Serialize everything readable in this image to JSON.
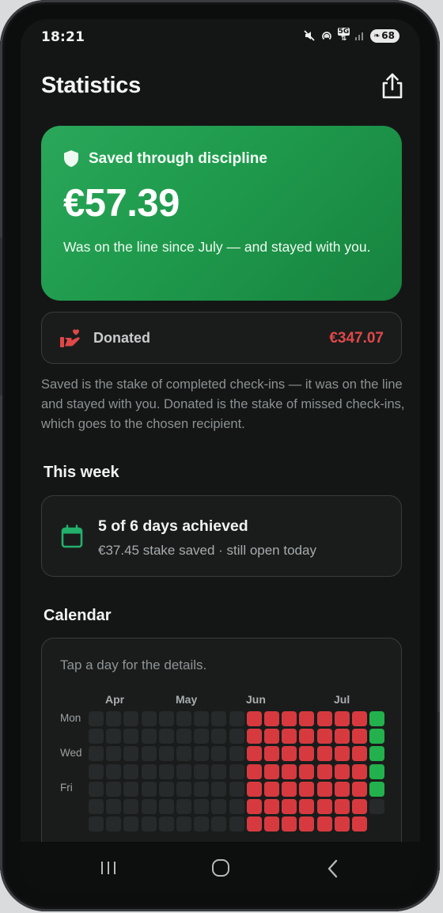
{
  "status_bar": {
    "time": "18:21",
    "network": "5G",
    "battery": "68",
    "icons": [
      "mute-icon",
      "hotspot-icon",
      "5g-icon",
      "signal-icon",
      "battery-icon"
    ]
  },
  "header": {
    "title": "Statistics",
    "share_icon": "share-icon"
  },
  "saved": {
    "label": "Saved through discipline",
    "icon": "shield-icon",
    "amount": "€57.39",
    "note": "Was on the line since July — and stayed with you.",
    "color": "#22a352"
  },
  "donated": {
    "label": "Donated",
    "icon": "heart-hand-icon",
    "amount": "€347.07",
    "color": "#e04848"
  },
  "explanation": "Saved is the stake of completed check-ins — it was on the line and stayed with you. Donated is the stake of missed check-ins, which goes to the chosen recipient.",
  "this_week": {
    "title": "This week",
    "icon": "calendar-icon",
    "summary": "5 of 6 days achieved",
    "detail": "€37.45 stake saved · still open today"
  },
  "calendar": {
    "title": "Calendar",
    "hint": "Tap a day for the details.",
    "months": [
      "Apr",
      "May",
      "Jun",
      "Jul"
    ],
    "day_labels": [
      "Mon",
      "Wed",
      "Fri"
    ],
    "legend_colors": {
      "empty": "#262a2a",
      "missed": "#d63a3f",
      "achieved": "#22b14c"
    },
    "weeks": [
      [
        0,
        0,
        0,
        0,
        0,
        0,
        0
      ],
      [
        0,
        0,
        0,
        0,
        0,
        0,
        0
      ],
      [
        0,
        0,
        0,
        0,
        0,
        0,
        0
      ],
      [
        0,
        0,
        0,
        0,
        0,
        0,
        0
      ],
      [
        0,
        0,
        0,
        0,
        0,
        0,
        0
      ],
      [
        0,
        0,
        0,
        0,
        0,
        0,
        0
      ],
      [
        0,
        0,
        0,
        0,
        0,
        0,
        0
      ],
      [
        0,
        0,
        0,
        0,
        0,
        0,
        0
      ],
      [
        0,
        0,
        0,
        0,
        0,
        0,
        0
      ],
      [
        1,
        1,
        1,
        1,
        1,
        1,
        1
      ],
      [
        1,
        1,
        1,
        1,
        1,
        1,
        1
      ],
      [
        1,
        1,
        1,
        1,
        1,
        1,
        1
      ],
      [
        1,
        1,
        1,
        1,
        1,
        1,
        1
      ],
      [
        1,
        1,
        1,
        1,
        1,
        1,
        1
      ],
      [
        1,
        1,
        1,
        1,
        1,
        1,
        1
      ],
      [
        1,
        1,
        1,
        1,
        1,
        1,
        1
      ],
      [
        2,
        2,
        2,
        2,
        2,
        0,
        null
      ]
    ]
  },
  "nav": {
    "recent_icon": "recent-apps-icon",
    "home_icon": "home-icon",
    "back_icon": "back-icon"
  }
}
